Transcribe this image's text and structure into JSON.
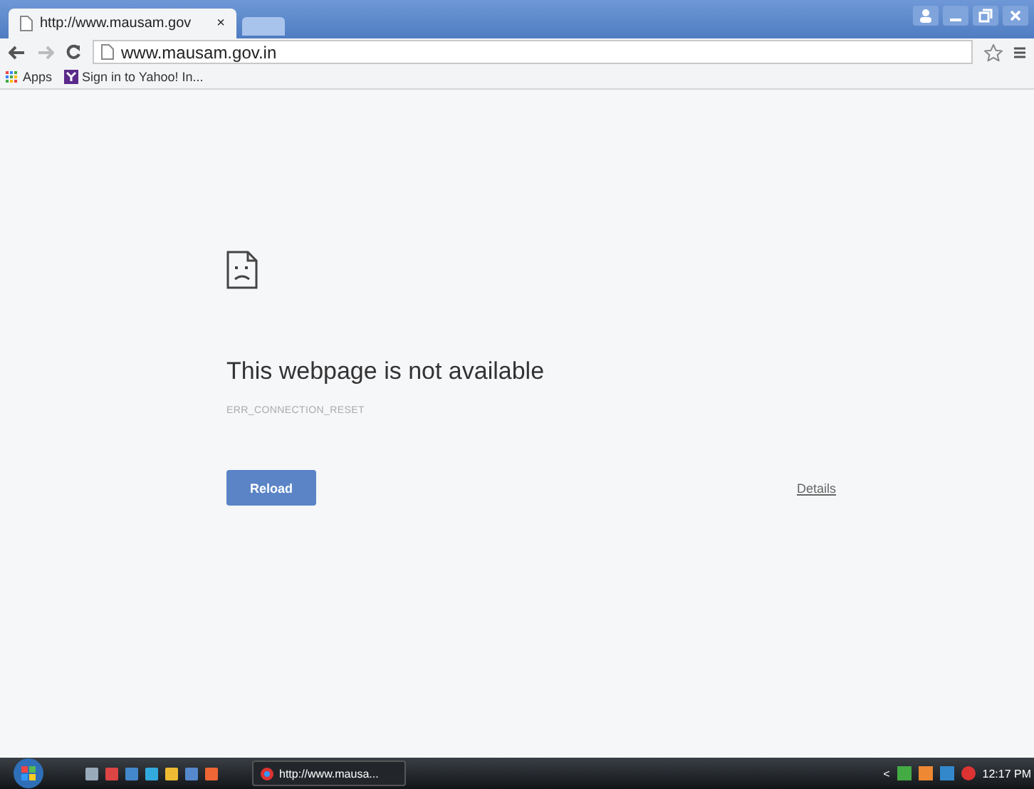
{
  "tab": {
    "title": "http://www.mausam.gov",
    "close": "×"
  },
  "address": {
    "value": "www.mausam.gov.in"
  },
  "bookmarks": [
    {
      "label": "Apps",
      "kind": "apps"
    },
    {
      "label": "Sign in to Yahoo! In...",
      "kind": "yahoo"
    }
  ],
  "error": {
    "title": "This webpage is not available",
    "code": "ERR_CONNECTION_RESET",
    "button": "Reload",
    "details": "Details"
  },
  "taskbar": {
    "window": "http://www.mausa...",
    "chevron": "<",
    "time": "12:17 PM"
  }
}
